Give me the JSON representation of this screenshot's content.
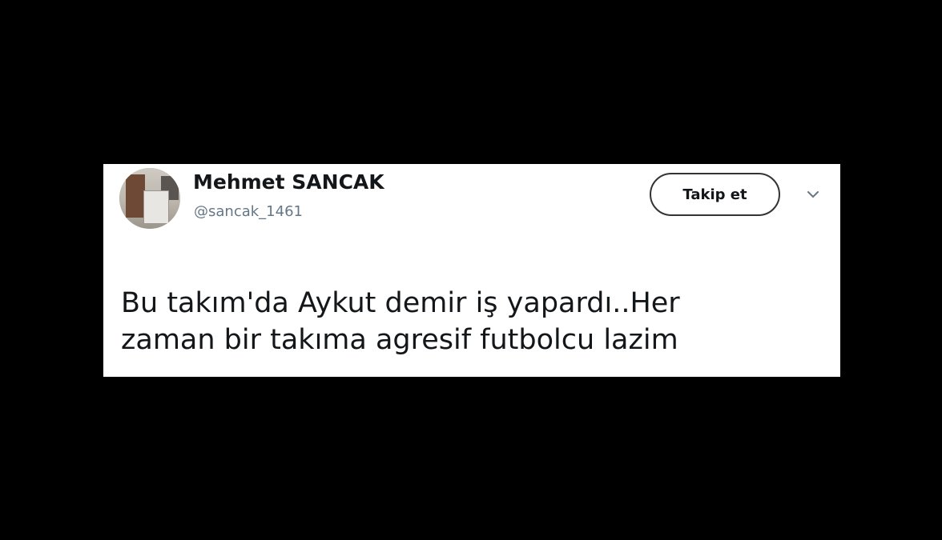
{
  "tweet": {
    "author": {
      "name": "Mehmet SANCAK",
      "handle": "@sancak_1461"
    },
    "follow_label": "Takip et",
    "text": "Bu takım'da Aykut demir iş yapardı..Her\nzaman bir takıma agresif futbolcu lazim"
  },
  "icons": {
    "menu": "chevron-down-icon"
  },
  "colors": {
    "background": "#000000",
    "card": "#ffffff",
    "text": "#14171a",
    "handle": "#657786"
  }
}
